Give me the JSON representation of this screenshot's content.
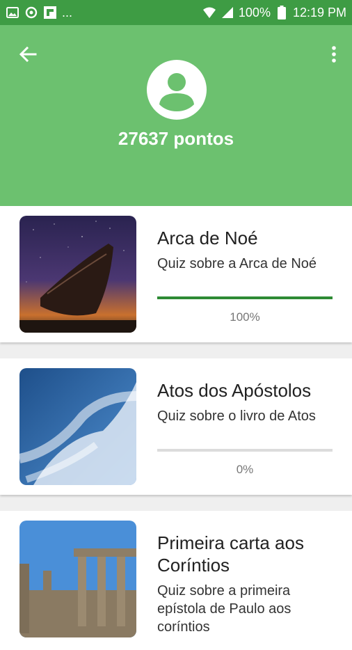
{
  "status_bar": {
    "dots": "...",
    "battery": "100%",
    "time": "12:19 PM"
  },
  "header": {
    "points": "27637 pontos",
    "colors": {
      "header": "#6cc16f",
      "status_bar": "#3e9c44",
      "progress": "#2e8b34"
    }
  },
  "quizzes": [
    {
      "title": "Arca de Noé",
      "description": "Quiz sobre a Arca de Noé",
      "progress_label": "100%",
      "progress": 1.0,
      "image": "ark-photo"
    },
    {
      "title": "Atos dos Apóstolos",
      "description": "Quiz sobre o livro de Atos",
      "progress_label": "0%",
      "progress": 0.0,
      "image": "sky-clouds-photo"
    },
    {
      "title": "Primeira carta aos Coríntios",
      "description": "Quiz sobre a primeira epístola de Paulo aos coríntios",
      "image": "ruins-columns-photo"
    }
  ]
}
